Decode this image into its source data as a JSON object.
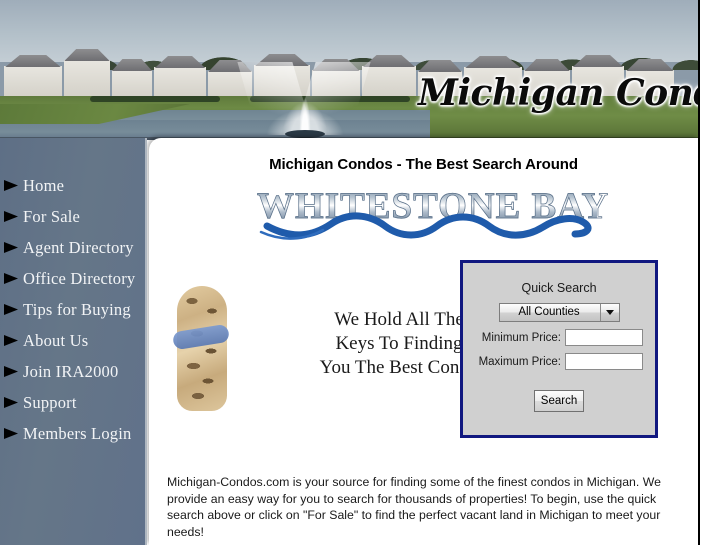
{
  "banner": {
    "wordmark": "Michigan Condos",
    "image_alt": "condos-pond-fountain-photo"
  },
  "sidebar": {
    "items": [
      {
        "label": "Home",
        "name": "sidebar-item-home"
      },
      {
        "label": "For Sale",
        "name": "sidebar-item-for-sale"
      },
      {
        "label": "Agent Directory",
        "name": "sidebar-item-agent-directory"
      },
      {
        "label": "Office Directory",
        "name": "sidebar-item-office-directory"
      },
      {
        "label": "Tips for Buying",
        "name": "sidebar-item-tips-for-buying"
      },
      {
        "label": "About Us",
        "name": "sidebar-item-about-us"
      },
      {
        "label": "Join IRA2000",
        "name": "sidebar-item-join-ira2000"
      },
      {
        "label": "Support",
        "name": "sidebar-item-support"
      },
      {
        "label": "Members Login",
        "name": "sidebar-item-members-login"
      }
    ]
  },
  "main": {
    "headline": "Michigan Condos - The Best Search Around",
    "brand_wordmark": "WHITESTONE BAY",
    "slogan_line1": "We Hold All The",
    "slogan_line2": "Keys To Finding",
    "slogan_line3": "You The Best Condo",
    "intro_paragraph": "Michigan-Condos.com is your source for finding some of the finest condos in Michigan. We provide an easy way for you to search for thousands of properties! To begin, use the quick search above or click on \"For Sale\" to find the perfect vacant land in Michigan to meet your needs!"
  },
  "quick_search": {
    "title": "Quick Search",
    "county_selected": "All Counties",
    "county_options": [
      "All Counties"
    ],
    "minimum_price_label": "Minimum Price:",
    "minimum_price_value": "",
    "maximum_price_label": "Maximum Price:",
    "maximum_price_value": "",
    "search_button_label": "Search"
  },
  "colors": {
    "sidebar_bg": "#62728a",
    "quick_search_border": "#111880",
    "quick_search_bg": "#d0d0d0",
    "brand_wave": "#1f5bab",
    "content_bg": "#ffffff"
  }
}
